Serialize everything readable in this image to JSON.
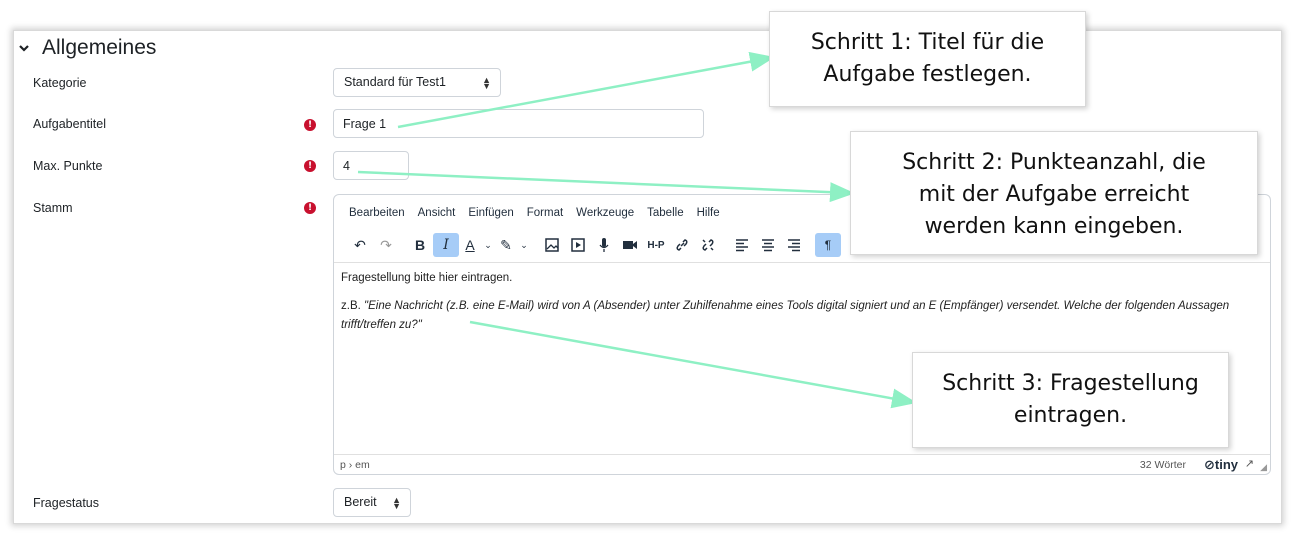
{
  "section": {
    "title": "Allgemeines"
  },
  "form": {
    "category": {
      "label": "Kategorie",
      "value": "Standard für Test1"
    },
    "title": {
      "label": "Aufgabentitel",
      "value": "Frage 1"
    },
    "points": {
      "label": "Max. Punkte",
      "value": "4"
    },
    "stem": {
      "label": "Stamm"
    },
    "status": {
      "label": "Fragestatus",
      "value": "Bereit"
    }
  },
  "editor": {
    "menu": [
      "Bearbeiten",
      "Ansicht",
      "Einfügen",
      "Format",
      "Werkzeuge",
      "Tabelle",
      "Hilfe"
    ],
    "toolbar": {
      "undo": "↶",
      "redo": "↷",
      "bold": "B",
      "italic": "I",
      "font_color": "A",
      "highlight": "✎",
      "h5p": "H-P",
      "ltr": "¶"
    },
    "content": {
      "line1": "Fragestellung bitte hier eintragen.",
      "prefix": "z.B. ",
      "example": "\"Eine Nachricht (z.B. eine E-Mail) wird von A (Absender) unter Zuhilfenahme eines Tools digital signiert und an E (Empfänger) versendet. Welche der folgenden Aussagen trifft/treffen zu?\""
    },
    "status": {
      "path": "p › em",
      "words": "32 Wörter",
      "brand": "tiny"
    }
  },
  "callouts": {
    "step1": {
      "line1": "Schritt 1: Titel für die",
      "line2": "Aufgabe festlegen."
    },
    "step2": {
      "line1": "Schritt 2: Punkteanzahl, die",
      "line2": "mit der Aufgabe erreicht",
      "line3": "werden kann eingeben."
    },
    "step3": {
      "line1": "Schritt 3: Fragestellung",
      "line2": "eintragen."
    }
  },
  "colors": {
    "arrow": "#8ef0c4",
    "required": "#c8102e",
    "active_button": "#a6ccf7"
  }
}
